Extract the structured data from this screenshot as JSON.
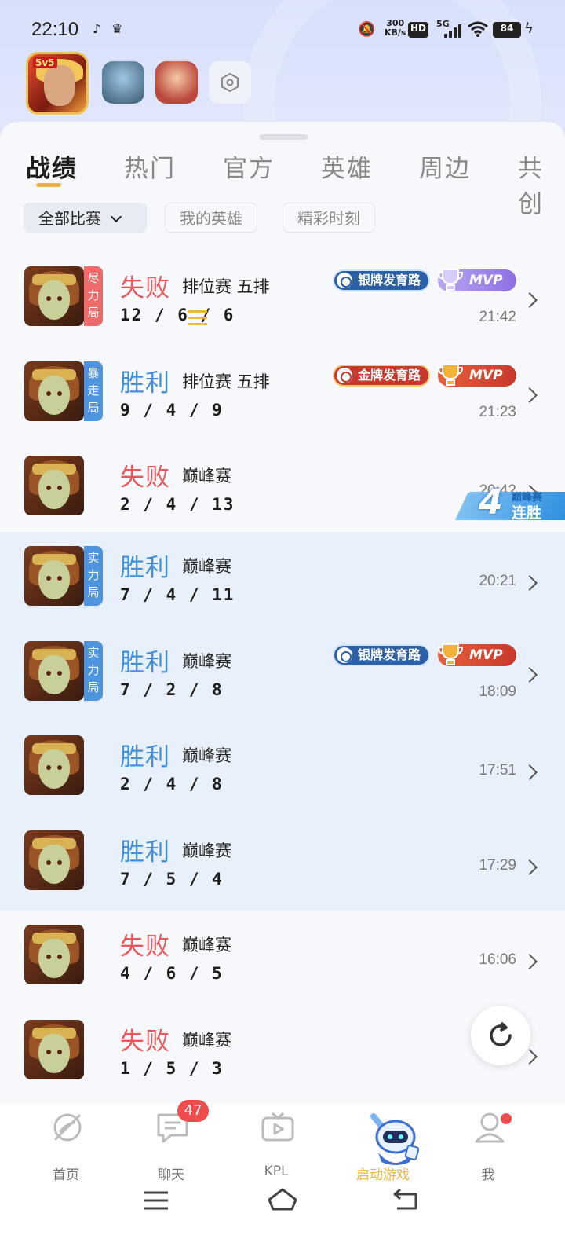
{
  "status_bar": {
    "time": "22:10",
    "net_speed_value": "300",
    "net_speed_unit": "KB/s",
    "hd": "HD",
    "network": "5G",
    "battery": "84"
  },
  "apps": {
    "selected_tag": "5v5"
  },
  "tabs": [
    "战绩",
    "热门",
    "官方",
    "英雄",
    "周边",
    "共创"
  ],
  "filters": [
    "全部比赛",
    "我的英雄",
    "精彩时刻"
  ],
  "lane_names": {
    "silver": "银牌发育路",
    "gold": "金牌发育路"
  },
  "mvp_label": "MVP",
  "matches": [
    {
      "result": "失败",
      "outcome": "lose",
      "mode": "排位赛 五排",
      "kda": "12 / 6 / 6",
      "time": "21:42",
      "badge": "尽力局",
      "badge_color": "red",
      "lane": "silver",
      "mvp": "silver",
      "bars": true,
      "highlight": false
    },
    {
      "result": "胜利",
      "outcome": "win",
      "mode": "排位赛 五排",
      "kda": "9 / 4 / 9",
      "time": "21:23",
      "badge": "暴走局",
      "badge_color": "blue",
      "lane": "gold",
      "mvp": "gold",
      "bars": false,
      "highlight": false
    },
    {
      "result": "失败",
      "outcome": "lose",
      "mode": "巅峰赛",
      "kda": "2 / 4 / 13",
      "time": "20:42",
      "badge": "",
      "badge_color": "",
      "lane": "",
      "mvp": "",
      "bars": false,
      "highlight": false
    },
    {
      "result": "胜利",
      "outcome": "win",
      "mode": "巅峰赛",
      "kda": "7 / 4 / 11",
      "time": "20:21",
      "badge": "实力局",
      "badge_color": "blue",
      "lane": "",
      "mvp": "",
      "bars": false,
      "highlight": true
    },
    {
      "result": "胜利",
      "outcome": "win",
      "mode": "巅峰赛",
      "kda": "7 / 2 / 8",
      "time": "18:09",
      "badge": "实力局",
      "badge_color": "blue",
      "lane": "silver",
      "mvp": "gold",
      "bars": false,
      "highlight": true
    },
    {
      "result": "胜利",
      "outcome": "win",
      "mode": "巅峰赛",
      "kda": "2 / 4 / 8",
      "time": "17:51",
      "badge": "",
      "badge_color": "",
      "lane": "",
      "mvp": "",
      "bars": false,
      "highlight": true
    },
    {
      "result": "胜利",
      "outcome": "win",
      "mode": "巅峰赛",
      "kda": "7 / 5 / 4",
      "time": "17:29",
      "badge": "",
      "badge_color": "",
      "lane": "",
      "mvp": "",
      "bars": false,
      "highlight": true
    },
    {
      "result": "失败",
      "outcome": "lose",
      "mode": "巅峰赛",
      "kda": "4 / 6 / 5",
      "time": "16:06",
      "badge": "",
      "badge_color": "",
      "lane": "",
      "mvp": "",
      "bars": false,
      "highlight": false
    },
    {
      "result": "失败",
      "outcome": "lose",
      "mode": "巅峰赛",
      "kda": "1 / 5 / 3",
      "time": "",
      "badge": "",
      "badge_color": "",
      "lane": "",
      "mvp": "",
      "bars": false,
      "highlight": false
    }
  ],
  "streak": {
    "count": "4",
    "mode": "巅峰赛",
    "label": "连胜"
  },
  "nav": [
    {
      "label": "首页",
      "icon": "home-icon",
      "active": false
    },
    {
      "label": "聊天",
      "icon": "chat-icon",
      "active": false,
      "badge": "47"
    },
    {
      "label": "KPL",
      "icon": "tv-icon",
      "active": false
    },
    {
      "label": "启动游戏",
      "icon": "robot-icon",
      "active": true
    },
    {
      "label": "我",
      "icon": "person-icon",
      "active": false,
      "dot": true
    }
  ],
  "colors": {
    "accent": "#f0b540",
    "win": "#3f8fdd",
    "lose": "#e8555a",
    "badge_red": "#ef6a69",
    "badge_blue": "#4d95e0"
  }
}
